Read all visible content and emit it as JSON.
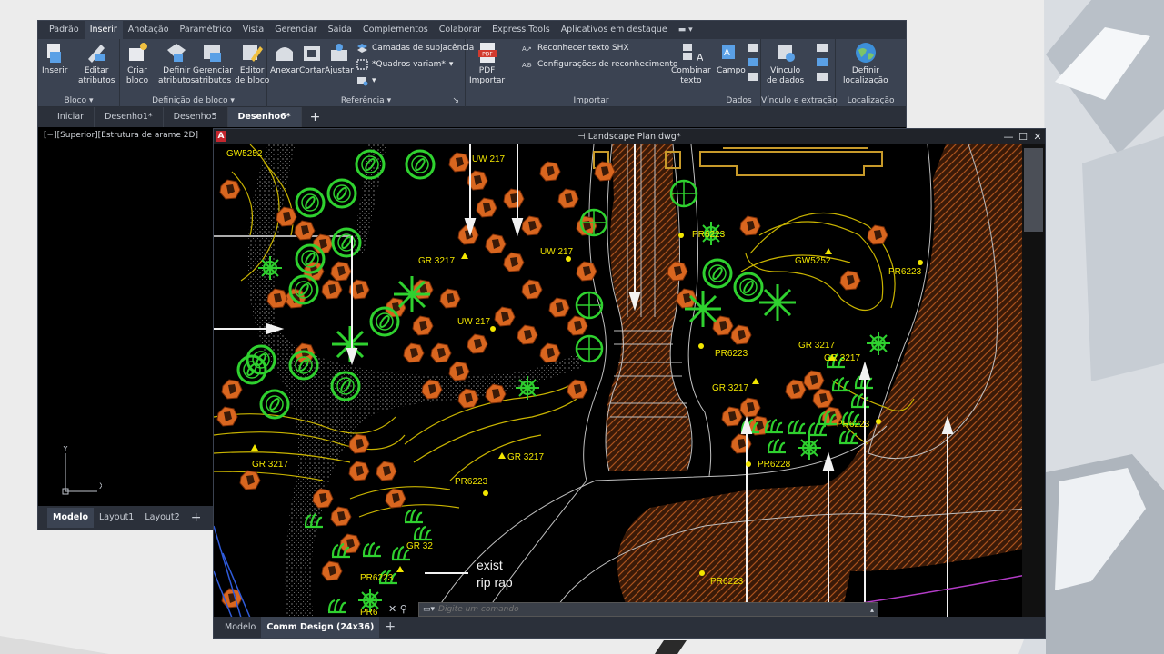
{
  "ribbon": {
    "tabs": [
      "Padrão",
      "Inserir",
      "Anotação",
      "Paramétrico",
      "Vista",
      "Gerenciar",
      "Saída",
      "Complementos",
      "Colaborar",
      "Express Tools",
      "Aplicativos em destaque"
    ],
    "panels": {
      "bloco": {
        "title": "Bloco",
        "buttons": [
          "Inserir",
          "Editar\natributos"
        ]
      },
      "definicao": {
        "title": "Definição de bloco",
        "buttons": [
          "Criar\nbloco",
          "Definir\natributos",
          "Gerenciar\natributos",
          "Editor\nde bloco"
        ]
      },
      "referencia": {
        "title": "Referência",
        "buttons": [
          "Anexar",
          "Cortar",
          "Ajustar"
        ],
        "small": [
          "Camadas de subjacência",
          "*Quadros variam*"
        ]
      },
      "importar": {
        "title": "Importar",
        "buttons": [
          "PDF\nImportar",
          "Combinar\ntexto"
        ],
        "small": [
          "Reconhecer texto SHX",
          "Configurações de reconhecimento"
        ]
      },
      "dados": {
        "title": "Dados",
        "buttons": [
          "Campo"
        ]
      },
      "vinculo": {
        "title": "Vínculo e extração",
        "buttons": [
          "Vínculo\nde dados"
        ]
      },
      "localizacao": {
        "title": "Localização",
        "buttons": [
          "Definir\nlocalização"
        ]
      }
    }
  },
  "doc_tabs": [
    "Iniciar",
    "Desenho1*",
    "Desenho5",
    "Desenho6*"
  ],
  "back_view_label": "[−][Superior][Estrutura de arame 2D]",
  "back_layout_tabs": [
    "Modelo",
    "Layout1",
    "Layout2"
  ],
  "front": {
    "title": "Landscape Plan.dwg*",
    "command_placeholder": "Digite um comando",
    "layout_tabs": [
      "Modelo",
      "Comm Design (24x36)"
    ]
  },
  "drawing_labels": [
    "GW5252",
    "UW 217",
    "UW 217",
    "GR 3217",
    "UW 217",
    "GR 3217",
    "GR 3217",
    "PR6223",
    "GR 3217",
    "PR6223",
    "GW5252",
    "PR6223",
    "PR6223",
    "GR 3217",
    "GR 3217",
    "PR6223",
    "PR6228",
    "PR6223",
    "PR6223",
    "PR6",
    "GR 32"
  ],
  "annotation": {
    "line1": "exist",
    "line2": "rip rap"
  },
  "colors": {
    "accent": "#3b4352",
    "plant_green": "#2fd12f",
    "shrub_orange": "#d9661f",
    "label_yellow": "#f2e600",
    "contour_yellow": "#c9b400"
  }
}
